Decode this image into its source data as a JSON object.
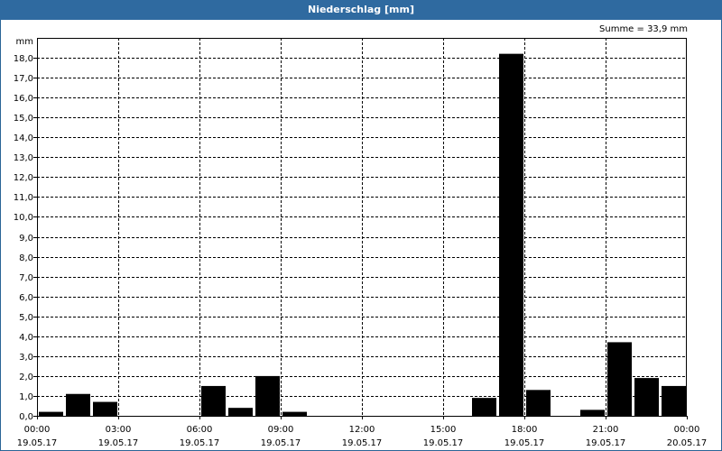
{
  "window": {
    "title": "Niederschlag [mm]"
  },
  "chart_data": {
    "type": "bar",
    "title": "Niederschlag [mm]",
    "ylabel": "mm",
    "summary": "Summe = 33,9 mm",
    "ylim": [
      0,
      19
    ],
    "yticks": [
      {
        "v": 0,
        "label": "0,0"
      },
      {
        "v": 1,
        "label": "1,0"
      },
      {
        "v": 2,
        "label": "2,0"
      },
      {
        "v": 3,
        "label": "3,0"
      },
      {
        "v": 4,
        "label": "4,0"
      },
      {
        "v": 5,
        "label": "5,0"
      },
      {
        "v": 6,
        "label": "6,0"
      },
      {
        "v": 7,
        "label": "7,0"
      },
      {
        "v": 8,
        "label": "8,0"
      },
      {
        "v": 9,
        "label": "9,0"
      },
      {
        "v": 10,
        "label": "10,0"
      },
      {
        "v": 11,
        "label": "11,0"
      },
      {
        "v": 12,
        "label": "12,0"
      },
      {
        "v": 13,
        "label": "13,0"
      },
      {
        "v": 14,
        "label": "14,0"
      },
      {
        "v": 15,
        "label": "15,0"
      },
      {
        "v": 16,
        "label": "16,0"
      },
      {
        "v": 17,
        "label": "17,0"
      },
      {
        "v": 18,
        "label": "18,0"
      }
    ],
    "xticks": [
      {
        "time": "00:00",
        "date": "19.05.17"
      },
      {
        "time": "03:00",
        "date": "19.05.17"
      },
      {
        "time": "06:00",
        "date": "19.05.17"
      },
      {
        "time": "09:00",
        "date": "19.05.17"
      },
      {
        "time": "12:00",
        "date": "19.05.17"
      },
      {
        "time": "15:00",
        "date": "19.05.17"
      },
      {
        "time": "18:00",
        "date": "19.05.17"
      },
      {
        "time": "21:00",
        "date": "19.05.17"
      },
      {
        "time": "00:00",
        "date": "20.05.17"
      }
    ],
    "categories": [
      "00:00",
      "01:00",
      "02:00",
      "03:00",
      "04:00",
      "05:00",
      "06:00",
      "07:00",
      "08:00",
      "09:00",
      "10:00",
      "11:00",
      "12:00",
      "13:00",
      "14:00",
      "15:00",
      "16:00",
      "17:00",
      "18:00",
      "19:00",
      "20:00",
      "21:00",
      "22:00",
      "23:00"
    ],
    "values": [
      0.2,
      1.1,
      0.7,
      0,
      0,
      0,
      1.5,
      0.4,
      2.0,
      0.2,
      0,
      0,
      0,
      0,
      0,
      0,
      0.9,
      18.2,
      1.3,
      0,
      0.3,
      3.7,
      1.9,
      1.5
    ],
    "bar_color": "#000000",
    "grid": true
  }
}
